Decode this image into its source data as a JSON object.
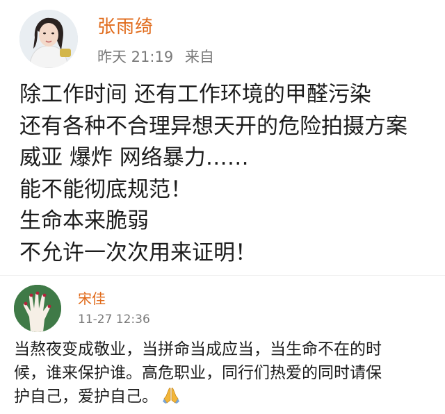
{
  "post": {
    "author": "张雨绮",
    "time": "昨天 21:19",
    "source": "来自",
    "lines": [
      "除工作时间 还有工作环境的甲醛污染",
      "还有各种不合理异想天开的危险拍摄方案",
      "威亚 爆炸 网络暴力……",
      "能不能彻底规范！",
      "生命本来脆弱",
      "不允许一次次用来证明！"
    ]
  },
  "comment": {
    "author": "宋佳",
    "time": "11-27 12:36",
    "lines": [
      "当熬夜变成敬业，当拼命当成应当，当生命不在的时",
      "候，谁来保护谁。高危职业，同行们热爱的同时请保",
      "护自己，爱护自己。"
    ],
    "emoji_icon": "praying-hands-icon"
  },
  "colors": {
    "name": "#e06a1a",
    "meta": "#7a7a7a",
    "text": "#1c1c1c"
  }
}
